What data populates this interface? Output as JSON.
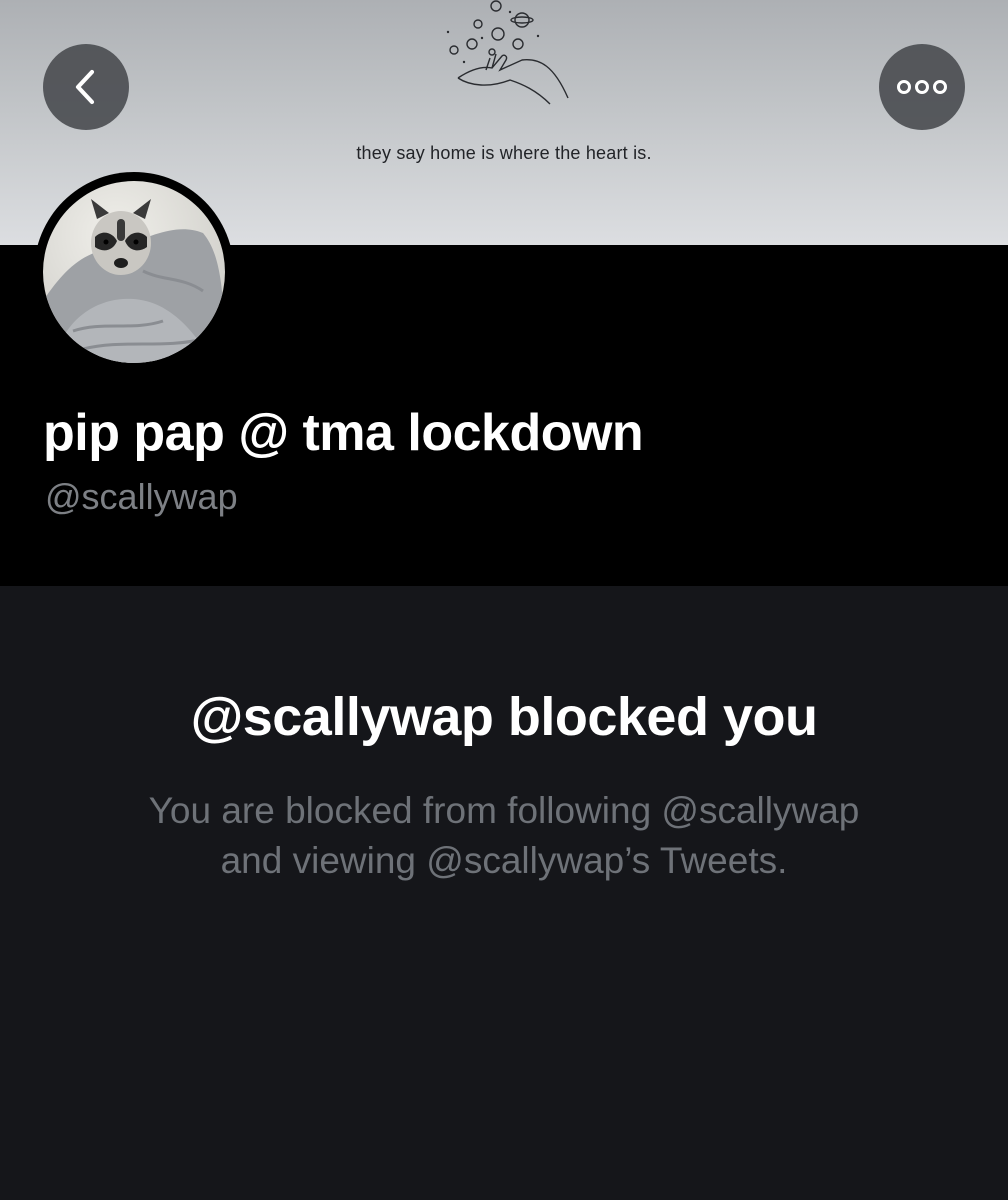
{
  "header": {
    "banner_quote": "they say home is where the heart is.",
    "back_icon": "chevron-left-icon",
    "more_icon": "more-horizontal-icon"
  },
  "profile": {
    "display_name": "pip pap @ tma lockdown",
    "handle": "@scallywap",
    "avatar": "raccoon-in-blanket"
  },
  "blocked": {
    "title": "@scallywap blocked you",
    "line1": "You are blocked from following @scallywap",
    "line2": "and viewing @scallywap’s Tweets."
  },
  "colors": {
    "background": "#15161a",
    "profile_background": "#000000",
    "primary_text": "#ffffff",
    "secondary_text": "#6e7278",
    "button_overlay": "#4c4e52"
  }
}
